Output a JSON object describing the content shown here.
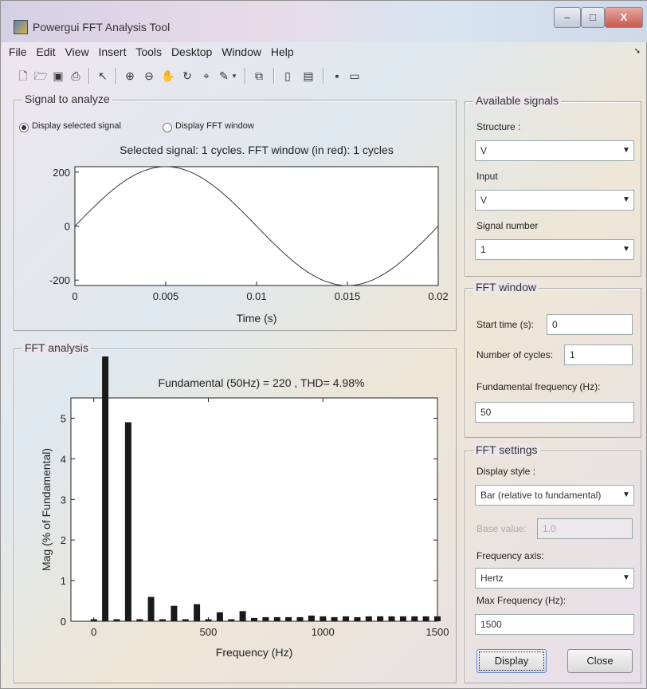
{
  "window": {
    "title": "Powergui FFT Analysis Tool",
    "min_symbol": "–",
    "max_symbol": "□",
    "close_symbol": "X"
  },
  "menu": [
    "File",
    "Edit",
    "View",
    "Insert",
    "Tools",
    "Desktop",
    "Window",
    "Help"
  ],
  "signal_panel": {
    "title": "Signal to analyze",
    "radio_selected": "Display selected signal",
    "radio_fft": "Display FFT window",
    "plot_title": "Selected signal: 1 cycles. FFT window (in red): 1 cycles",
    "xlabel": "Time (s)"
  },
  "fft_panel": {
    "title": "FFT analysis",
    "plot_title": "Fundamental (50Hz) = 220 , THD= 4.98%",
    "xlabel": "Frequency (Hz)",
    "ylabel": "Mag (% of Fundamental)"
  },
  "available_signals": {
    "title": "Available signals",
    "structure_label": "Structure :",
    "structure_value": "V",
    "input_label": "Input",
    "input_value": "V",
    "signal_number_label": "Signal number",
    "signal_number_value": "1"
  },
  "fft_window": {
    "title": "FFT window",
    "start_time_label": "Start time (s):",
    "start_time_value": "0",
    "cycles_label": "Number of cycles:",
    "cycles_value": "1",
    "fund_freq_label": "Fundamental frequency (Hz):",
    "fund_freq_value": "50"
  },
  "fft_settings": {
    "title": "FFT settings",
    "display_style_label": "Display style :",
    "display_style_value": "Bar (relative to fundamental)",
    "base_value_label": "Base value:",
    "base_value_value": "1.0",
    "freq_axis_label": "Frequency axis:",
    "freq_axis_value": "Hertz",
    "max_freq_label": "Max Frequency (Hz):",
    "max_freq_value": "1500"
  },
  "buttons": {
    "display": "Display",
    "close": "Close"
  },
  "chart_data": [
    {
      "type": "line",
      "title": "Selected signal: 1 cycles. FFT window (in red): 1 cycles",
      "xlabel": "Time (s)",
      "ylabel": "",
      "xlim": [
        0,
        0.02
      ],
      "ylim": [
        -220,
        220
      ],
      "xticks": [
        "0",
        "0.005",
        "0.01",
        "0.015",
        "0.02"
      ],
      "yticks": [
        "200",
        "0",
        "-200"
      ],
      "signal": {
        "amplitude": 220,
        "frequency_hz": 50
      }
    },
    {
      "type": "bar",
      "title": "Fundamental (50Hz) = 220 , THD= 4.98%",
      "xlabel": "Frequency (Hz)",
      "ylabel": "Mag (% of Fundamental)",
      "xlim": [
        -100,
        1500
      ],
      "ylim": [
        0,
        5.5
      ],
      "xticks": [
        "0",
        "500",
        "1000",
        "1500"
      ],
      "yticks": [
        "0",
        "1",
        "2",
        "3",
        "4",
        "5"
      ],
      "x": [
        0,
        50,
        100,
        150,
        200,
        250,
        300,
        350,
        400,
        450,
        500,
        550,
        600,
        650,
        700,
        750,
        800,
        850,
        900,
        950,
        1000,
        1050,
        1100,
        1150,
        1200,
        1250,
        1300,
        1350,
        1400,
        1450,
        1500
      ],
      "values": [
        0.05,
        100,
        0.05,
        4.9,
        0.05,
        0.6,
        0.05,
        0.38,
        0.05,
        0.42,
        0.05,
        0.22,
        0.05,
        0.25,
        0.08,
        0.1,
        0.1,
        0.1,
        0.1,
        0.14,
        0.12,
        0.1,
        0.12,
        0.1,
        0.12,
        0.12,
        0.12,
        0.12,
        0.12,
        0.12,
        0.12
      ]
    }
  ]
}
